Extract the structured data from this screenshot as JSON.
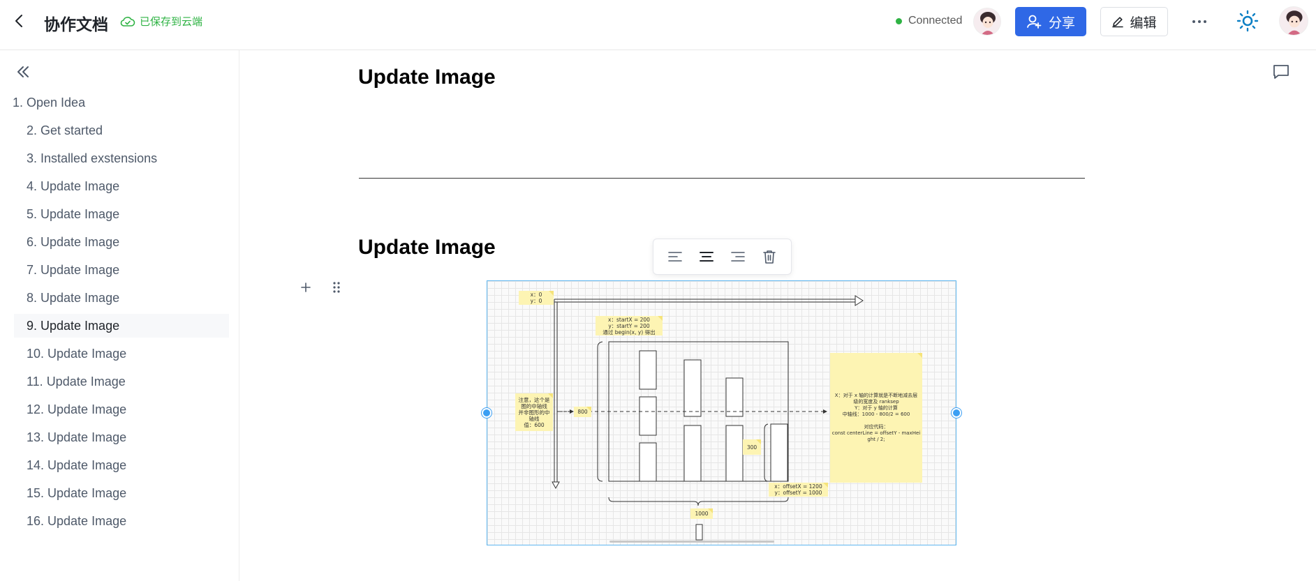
{
  "header": {
    "doc_title": "协作文档",
    "save_status": "已保存到云端",
    "connection_status": "Connected",
    "share_label": "分享",
    "edit_label": "编辑",
    "colors": {
      "accent": "#2f68e6",
      "saved": "#2fb344",
      "connected_dot": "#2fb344"
    }
  },
  "sidebar": {
    "items": [
      {
        "label": "1. Open Idea"
      },
      {
        "label": "2. Get started"
      },
      {
        "label": "3. Installed exstensions"
      },
      {
        "label": "4. Update Image"
      },
      {
        "label": "5. Update Image"
      },
      {
        "label": "6. Update Image"
      },
      {
        "label": "7. Update Image"
      },
      {
        "label": "8. Update Image"
      },
      {
        "label": "9. Update Image",
        "active": true
      },
      {
        "label": "10. Update Image"
      },
      {
        "label": "11. Update Image"
      },
      {
        "label": "12. Update Image"
      },
      {
        "label": "13. Update Image"
      },
      {
        "label": "14. Update Image"
      },
      {
        "label": "15. Update Image"
      },
      {
        "label": "16. Update Image"
      }
    ]
  },
  "content": {
    "heading_1": "Update Image",
    "heading_2": "Update Image"
  },
  "diagram": {
    "origin_note": "x：0\ny：0",
    "start_note": "x：startX = 200\ny：startY = 200\n通过 begin(x, y) 得出",
    "center_note": "注意，这个是\n图的中轴线\n并非图形的中\n轴线\n值：600",
    "label_800": "800",
    "label_300": "300",
    "offset_note": "x：offsetX = 1200\ny：offsetY = 1000",
    "label_1000": "1000",
    "explain_note": "X：对于 x 轴的计算就是不断地减去层\n级的宽度及 ranksep\nY：对于 y 轴的计算\n中轴线：1000 - 800/2 = 600\n\n对应代码：\nconst centerLine = offsetY - maxHei\nght / 2;"
  }
}
